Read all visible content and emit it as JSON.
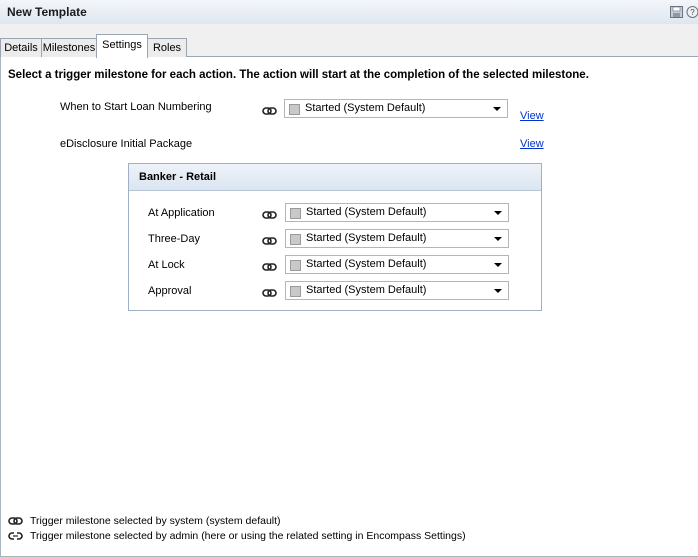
{
  "window": {
    "title": "New Template"
  },
  "tabs": [
    {
      "label": "Details"
    },
    {
      "label": "Milestones"
    },
    {
      "label": "Settings"
    },
    {
      "label": "Roles"
    }
  ],
  "active_tab": "Settings",
  "instruction": "Select a trigger milestone for each action. The action will start at the completion of the selected milestone.",
  "top_rows": [
    {
      "label": "When to Start Loan Numbering",
      "value": "Started (System Default)",
      "link": "View"
    },
    {
      "label": "eDisclosure Initial Package",
      "link": "View"
    }
  ],
  "panel": {
    "title": "Banker - Retail",
    "rows": [
      {
        "label": "At Application",
        "value": "Started (System Default)"
      },
      {
        "label": "Three-Day",
        "value": "Started (System Default)"
      },
      {
        "label": "At Lock",
        "value": "Started (System Default)"
      },
      {
        "label": "Approval",
        "value": "Started (System Default)"
      }
    ]
  },
  "legend": {
    "system": "Trigger milestone selected by system (system default)",
    "admin": "Trigger milestone selected by admin (here or using the related setting in Encompass Settings)"
  },
  "icons": {
    "save": "save-icon",
    "help": "help-icon",
    "system_link": "chain-link-icon",
    "admin_link": "broken-link-icon"
  },
  "colors": {
    "link": "#0033cc",
    "panel_header": "#dbe5f1",
    "tab_border": "#9aa5b1"
  }
}
